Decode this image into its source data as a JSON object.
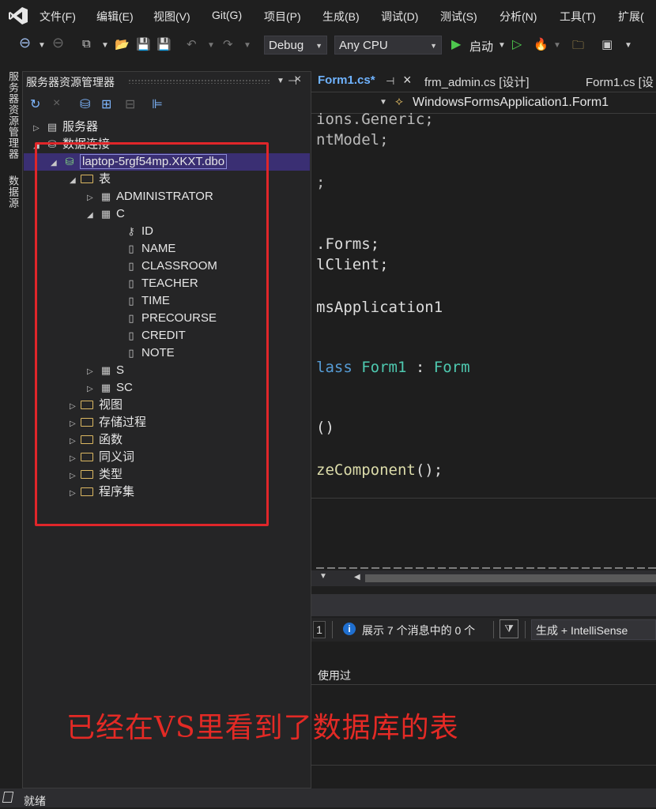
{
  "menu": [
    "文件(F)",
    "编辑(E)",
    "视图(V)",
    "Git(G)",
    "项目(P)",
    "生成(B)",
    "调试(D)",
    "测试(S)",
    "分析(N)",
    "工具(T)",
    "扩展("
  ],
  "toolbar": {
    "config": "Debug",
    "platform": "Any CPU",
    "start_label": "启动"
  },
  "side_tabs": [
    "服务器资源管理器",
    "数据源"
  ],
  "panel": {
    "title": "服务器资源管理器",
    "tree": {
      "servers": "服务器",
      "data_connections": "数据连接",
      "connection": "laptop-5rgf54mp.XKXT.dbo",
      "tables_folder": "表",
      "tables": [
        "ADMINISTRATOR",
        "C",
        "S",
        "SC"
      ],
      "columns_C": [
        "ID",
        "NAME",
        "CLASSROOM",
        "TEACHER",
        "TIME",
        "PRECOURSE",
        "CREDIT",
        "NOTE"
      ],
      "folders": [
        "视图",
        "存储过程",
        "函数",
        "同义词",
        "类型",
        "程序集"
      ]
    }
  },
  "tabs": [
    "Form1.cs*",
    "frm_admin.cs [设计]",
    "Form1.cs [设"
  ],
  "navbar_class": "WindowsFormsApplication1.Form1",
  "code": {
    "l1": "ions.Generic;",
    "l2": "ntModel;",
    "l3": ";",
    "l4": ".Forms;",
    "l5": "lClient;",
    "l6": "msApplication1",
    "l7a": "lass",
    "l7b": "Form1",
    "l7c": " : ",
    "l7d": "Form",
    "l8": "()",
    "l9a": "zeComponent",
    "l9b": "();"
  },
  "errors": {
    "count_box": "1",
    "message": "展示 7 个消息中的 0 个",
    "filter": "生成 + IntelliSense",
    "col": "使用过"
  },
  "status": "就绪",
  "annotation": "已经在VS里看到了数据库的表"
}
